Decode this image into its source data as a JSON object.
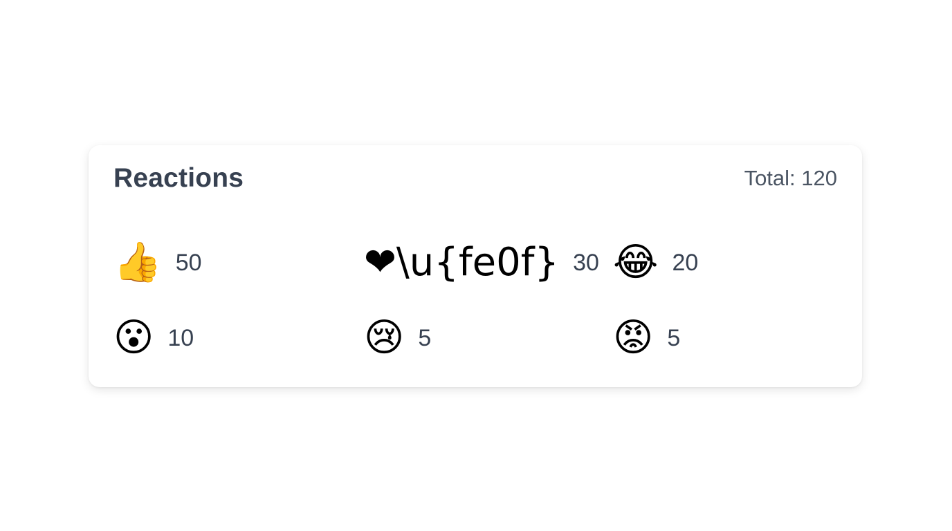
{
  "card": {
    "title": "Reactions",
    "total_label": "Total: 120"
  },
  "reactions": [
    {
      "emoji": "👍",
      "icon": "thumbs-up-icon",
      "count": "50"
    },
    {
      "emoji": "❤\\u{fe0f}",
      "icon": "heart-icon",
      "count": "30"
    },
    {
      "emoji": "😂",
      "icon": "tears-of-joy-icon",
      "count": "20"
    },
    {
      "emoji": "😮",
      "icon": "surprised-face-icon",
      "count": "10"
    },
    {
      "emoji": "😢",
      "icon": "crying-face-icon",
      "count": "5"
    },
    {
      "emoji": "😡",
      "icon": "angry-face-icon",
      "count": "5"
    }
  ]
}
